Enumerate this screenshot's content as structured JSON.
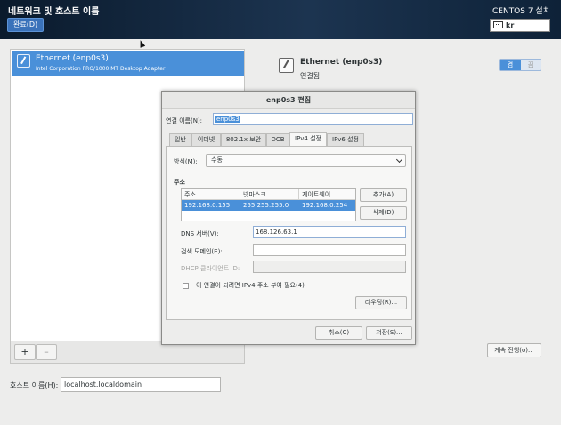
{
  "header": {
    "title": "네트워크 및 호스트 이름",
    "done_label": "완료(D)",
    "product": "CENTOS 7 설치",
    "keyboard_layout": "kr"
  },
  "device_list": {
    "items": [
      {
        "name": "Ethernet (enp0s3)",
        "description": "Intel Corporation PRO/1000 MT Desktop Adapter"
      }
    ],
    "add_label": "+",
    "remove_label": "–"
  },
  "device_summary": {
    "title": "Ethernet (enp0s3)",
    "status": "연결됨",
    "toggle_on": "켬",
    "toggle_off": "끔",
    "partial_text": ""
  },
  "hostname": {
    "label": "호스트 이름(H):",
    "value": "localhost.localdomain"
  },
  "continue_label": "계속 진행(o)...",
  "dialog": {
    "title": "enp0s3 편집",
    "connection_name_label": "연결 이름(N):",
    "connection_name_value": "enp0s3",
    "tabs": [
      "일반",
      "이더넷",
      "802.1x 보안",
      "DCB",
      "IPv4 설정",
      "IPv6 설정"
    ],
    "active_tab": "IPv4 설정",
    "method_label": "방식(M):",
    "method_value": "수동",
    "addresses_heading": "주소",
    "address_columns": [
      "주소",
      "넷마스크",
      "게이트웨이"
    ],
    "address_rows": [
      [
        "192.168.0.155",
        "255.255.255.0",
        "192.168.0.254"
      ]
    ],
    "add_button": "추가(A)",
    "delete_button": "삭제(D)",
    "dns_label": "DNS 서버(V):",
    "dns_value": "168.126.63.1",
    "search_domain_label": "검색 도메인(E):",
    "search_domain_value": "",
    "dhcp_client_id_label": "DHCP 클라이언트 ID:",
    "dhcp_client_id_value": "",
    "require_ipv4_label": "이 연결이 되려면 IPv4 주소 부여 필요(4)",
    "require_ipv4_checked": false,
    "routes_button": "라우팅(R)...",
    "cancel_button": "취소(C)",
    "save_button": "저장(S)..."
  },
  "colors": {
    "accent": "#4a90d9",
    "header_bg": "#1c3450",
    "done_button": "#3a72ba"
  }
}
